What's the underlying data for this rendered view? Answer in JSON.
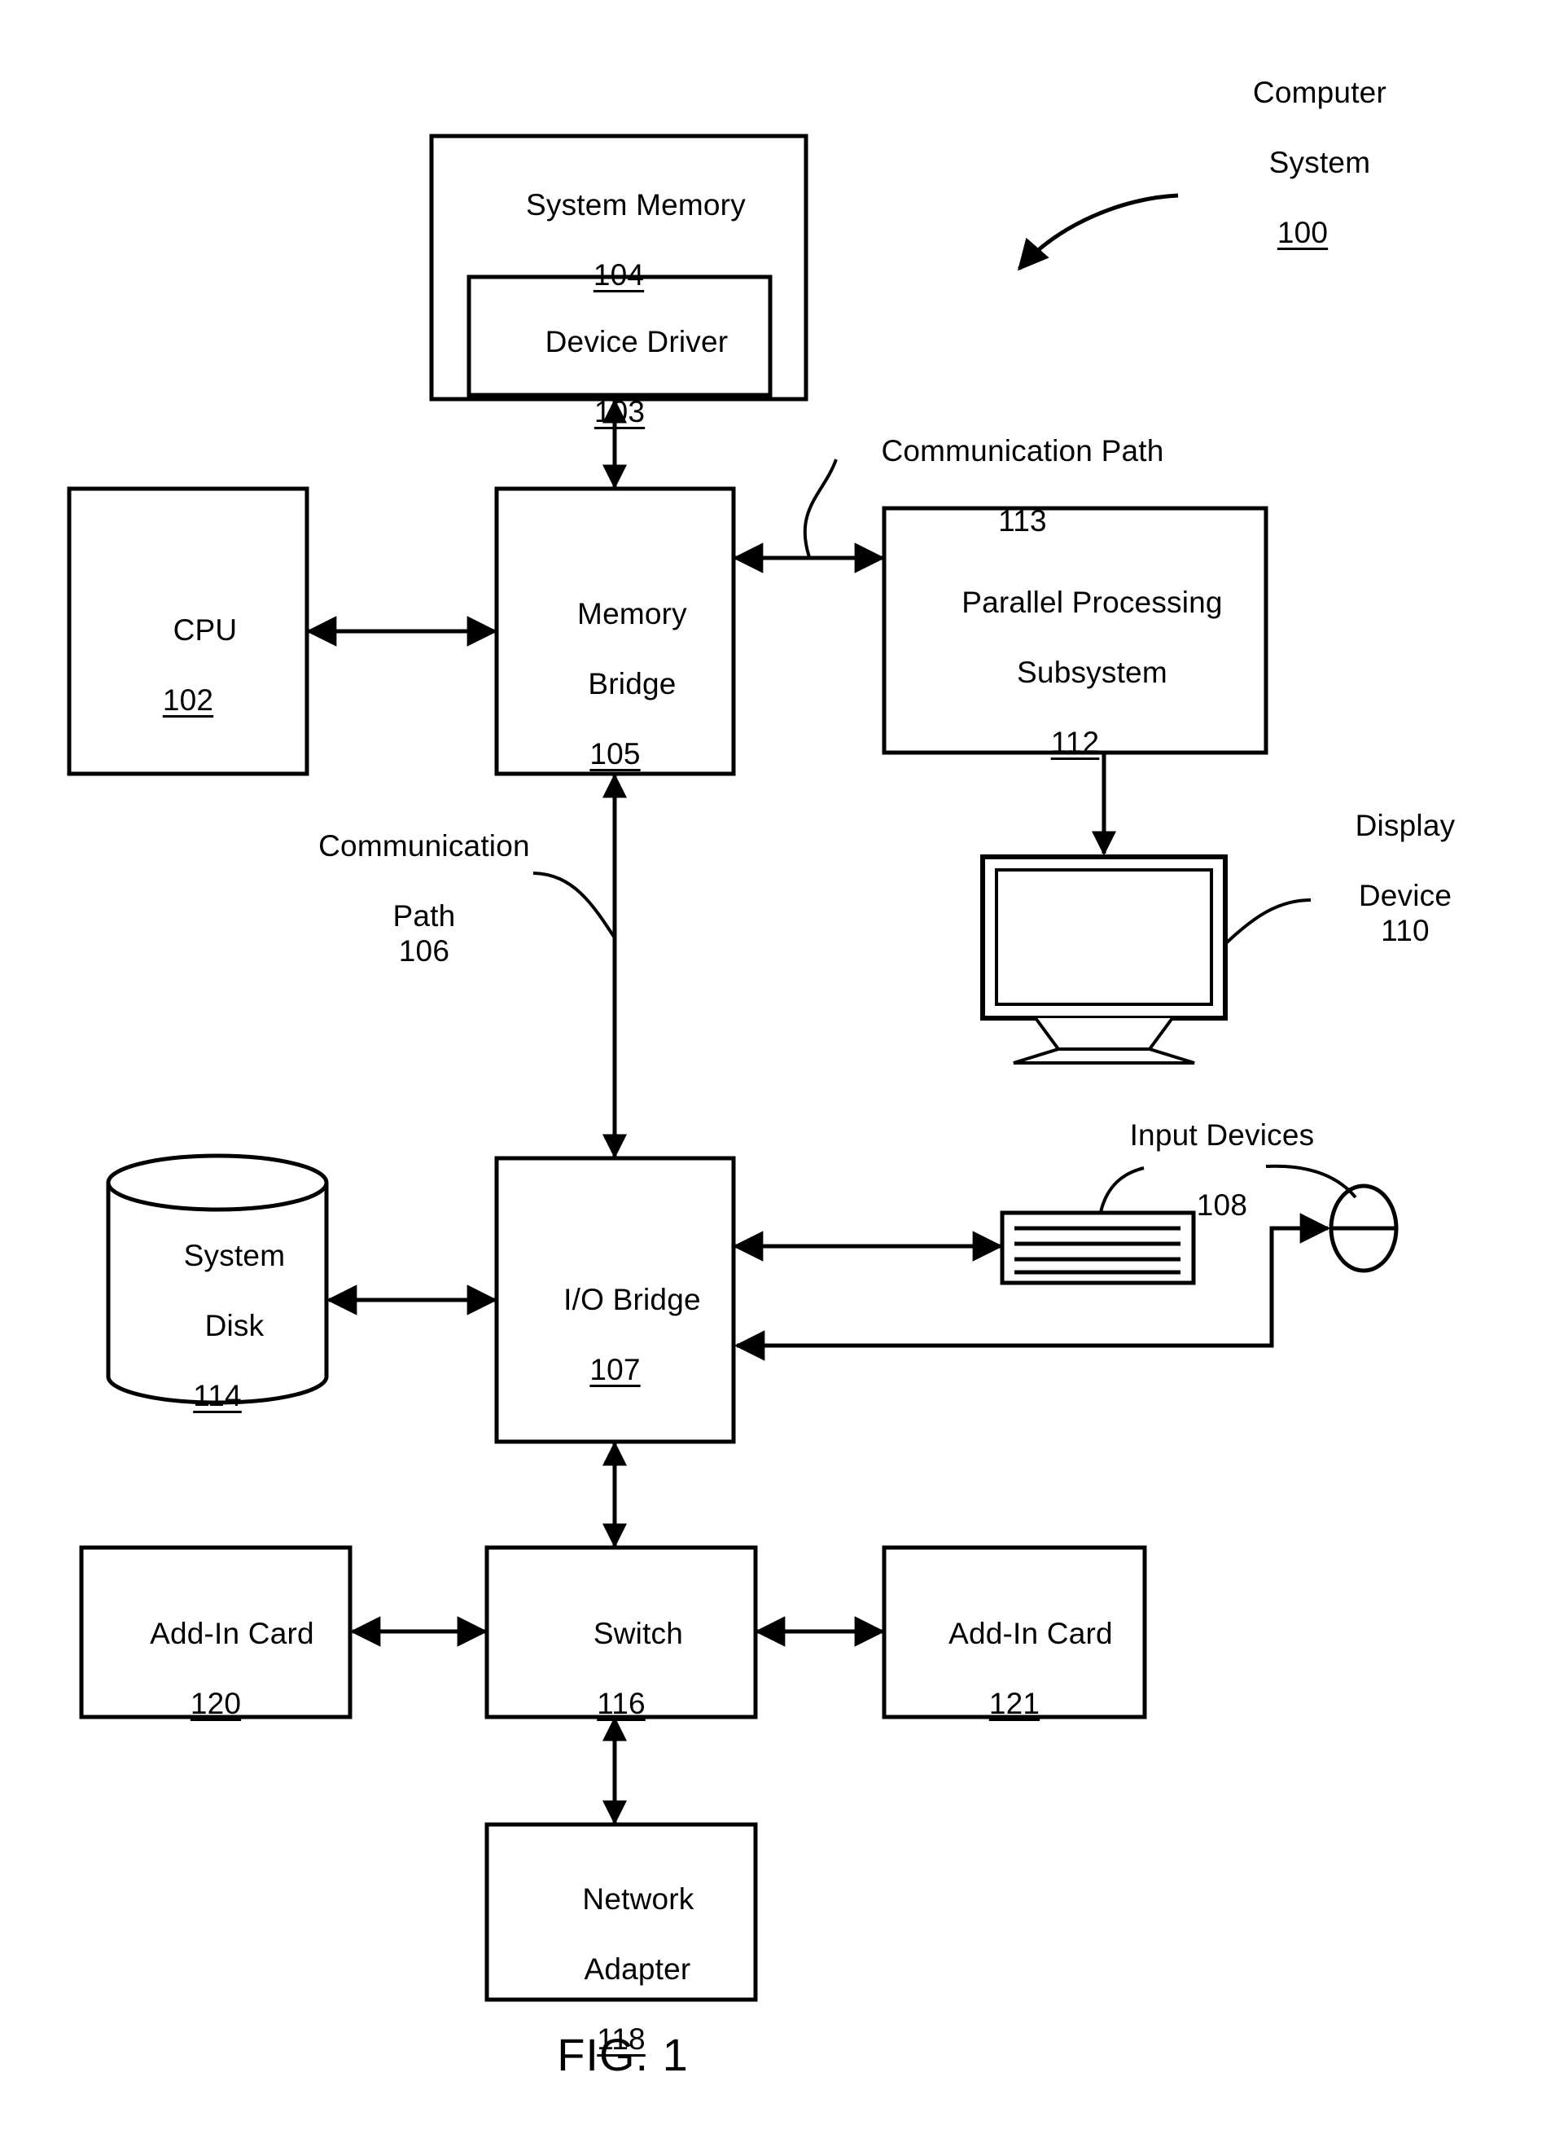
{
  "figure": {
    "caption": "FIG. 1",
    "title_callout": {
      "line1": "Computer",
      "line2": "System",
      "number": "100"
    }
  },
  "blocks": {
    "system_memory": {
      "label": "System Memory",
      "number": "104"
    },
    "device_driver": {
      "label": "Device Driver",
      "number": "103"
    },
    "cpu": {
      "label": "CPU",
      "number": "102"
    },
    "memory_bridge": {
      "line1": "Memory",
      "line2": "Bridge",
      "number": "105"
    },
    "parallel_processing_subsystem": {
      "line1": "Parallel Processing",
      "line2": "Subsystem",
      "number": "112"
    },
    "system_disk": {
      "line1": "System",
      "line2": "Disk",
      "number": "114"
    },
    "io_bridge": {
      "label": "I/O Bridge",
      "number": "107"
    },
    "switch": {
      "label": "Switch",
      "number": "116"
    },
    "add_in_card_120": {
      "label": "Add-In Card",
      "number": "120"
    },
    "add_in_card_121": {
      "label": "Add-In Card",
      "number": "121"
    },
    "network_adapter": {
      "line1": "Network",
      "line2": "Adapter",
      "number": "118"
    }
  },
  "callouts": {
    "communication_path_113": {
      "line1": "Communication Path",
      "number": "113"
    },
    "communication_path_106": {
      "line1": "Communication",
      "line2": "Path",
      "number": "106"
    },
    "display_device": {
      "line1": "Display",
      "line2": "Device",
      "number": "110"
    },
    "input_devices": {
      "label": "Input Devices",
      "number": "108"
    }
  },
  "icons": {
    "display_device": "monitor-icon",
    "keyboard": "keyboard-icon",
    "mouse": "mouse-icon",
    "system_disk": "cylinder-disk-icon"
  },
  "style": {
    "stroke": "#000000",
    "fill": "#ffffff",
    "background": "#ffffff"
  }
}
